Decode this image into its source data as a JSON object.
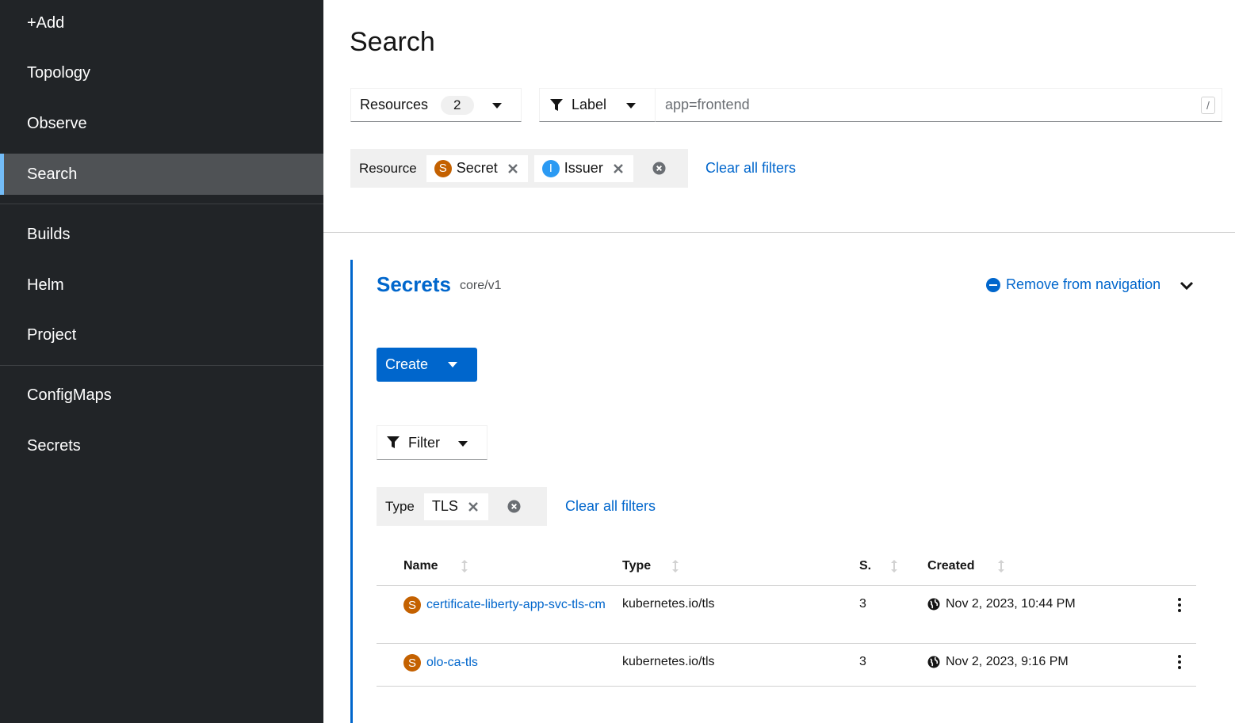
{
  "sidebar": {
    "items": [
      {
        "label": "+Add"
      },
      {
        "label": "Topology"
      },
      {
        "label": "Observe"
      },
      {
        "label": "Search",
        "active": true
      },
      {
        "label": "Builds"
      },
      {
        "label": "Helm"
      },
      {
        "label": "Project"
      },
      {
        "label": "ConfigMaps"
      },
      {
        "label": "Secrets"
      }
    ]
  },
  "page": {
    "title": "Search"
  },
  "toolbar": {
    "resources_label": "Resources",
    "resources_count": "2",
    "label_select": "Label",
    "label_input_value": "app=frontend",
    "shortcut_key": "/"
  },
  "resource_filters": {
    "group_label": "Resource",
    "chips": [
      {
        "badge": "S",
        "label": "Secret"
      },
      {
        "badge": "I",
        "label": "Issuer"
      }
    ],
    "clear_all": "Clear all filters"
  },
  "section": {
    "title": "Secrets",
    "api_version": "core/v1",
    "remove_nav": "Remove from navigation",
    "create_label": "Create",
    "filter_label": "Filter",
    "type_filter": {
      "group_label": "Type",
      "chip": "TLS",
      "clear_all": "Clear all filters"
    }
  },
  "table": {
    "columns": [
      "Name",
      "Type",
      "S.",
      "Created"
    ],
    "rows": [
      {
        "badge": "S",
        "name": "certificate-liberty-app-svc-tls-cm",
        "type": "kubernetes.io/tls",
        "size": "3",
        "created": "Nov 2, 2023, 10:44 PM"
      },
      {
        "badge": "S",
        "name": "olo-ca-tls",
        "type": "kubernetes.io/tls",
        "size": "3",
        "created": "Nov 2, 2023, 9:16 PM"
      }
    ]
  },
  "colors": {
    "sidebar_bg": "#212427",
    "active_bg": "#4f5255",
    "active_accent": "#73bcf7",
    "link": "#0066cc",
    "badge_secret": "#c46100",
    "badge_issuer": "#2b9af3"
  }
}
